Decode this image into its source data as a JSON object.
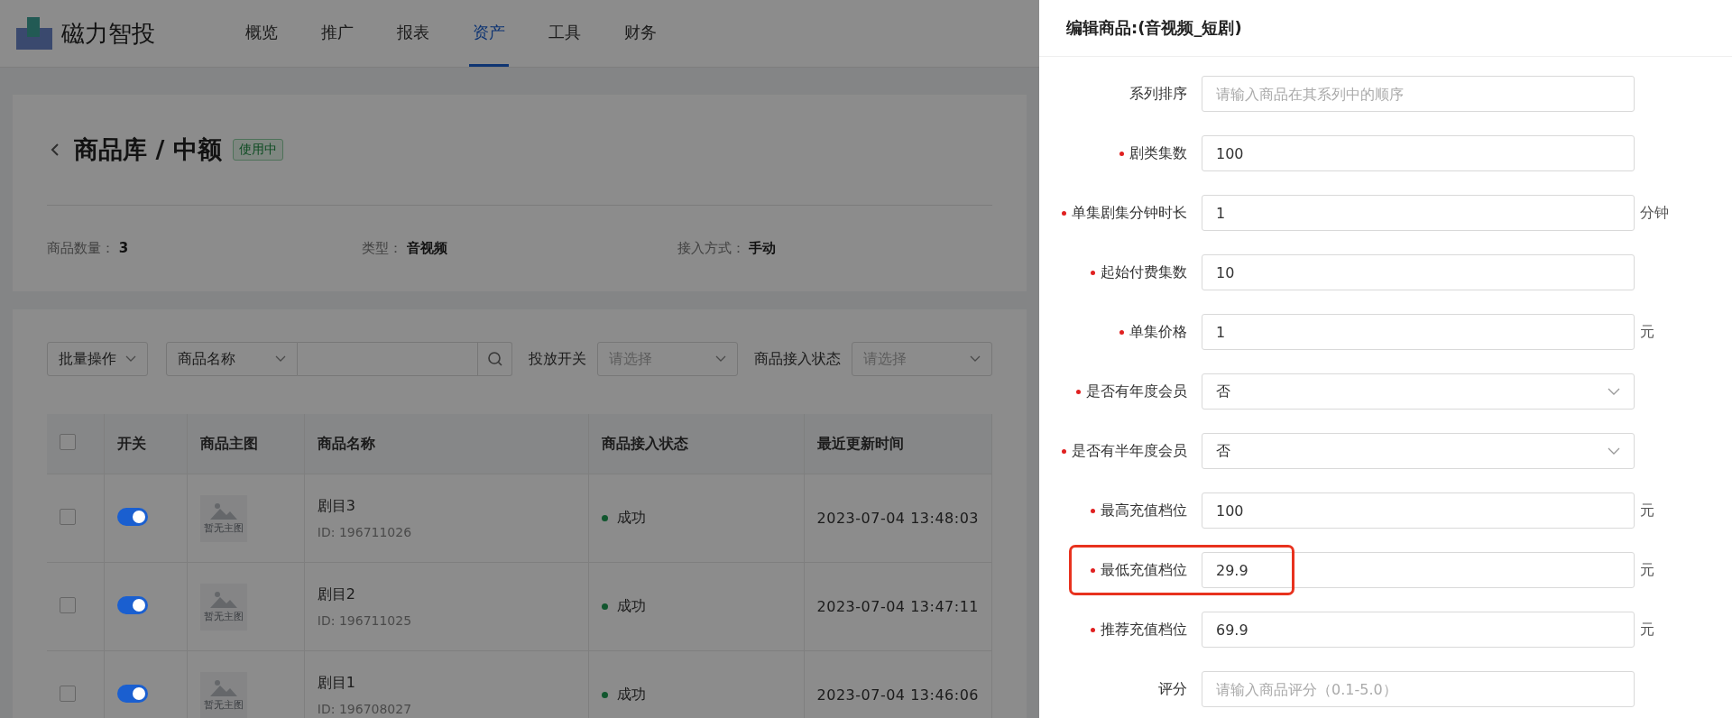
{
  "app": {
    "brand": "磁力智投"
  },
  "nav": [
    {
      "label": "概览",
      "selected": false
    },
    {
      "label": "推广",
      "selected": false
    },
    {
      "label": "报表",
      "selected": false
    },
    {
      "label": "资产",
      "selected": true
    },
    {
      "label": "工具",
      "selected": false
    },
    {
      "label": "财务",
      "selected": false
    }
  ],
  "page": {
    "title": "商品库 / 中额",
    "status_tag": "使用中"
  },
  "stats": [
    {
      "label": "商品数量：",
      "value": "3"
    },
    {
      "label": "类型：",
      "value": "音视频"
    },
    {
      "label": "接入方式：",
      "value": "手动"
    }
  ],
  "toolbar": {
    "batch": "批量操作",
    "search_type": "商品名称",
    "filters": [
      {
        "label": "投放开关",
        "placeholder": "请选择"
      },
      {
        "label": "商品接入状态",
        "placeholder": "请选择"
      }
    ]
  },
  "table": {
    "all_checked": false,
    "columns": [
      "开关",
      "商品主图",
      "商品名称",
      "商品接入状态",
      "最近更新时间"
    ],
    "rows": [
      {
        "checked": false,
        "on": true,
        "image_text": "暂无主图",
        "name": "剧目3",
        "id": "ID: 196711026",
        "status": "成功",
        "time": "2023-07-04 13:48:03"
      },
      {
        "checked": false,
        "on": true,
        "image_text": "暂无主图",
        "name": "剧目2",
        "id": "ID: 196711025",
        "status": "成功",
        "time": "2023-07-04 13:47:11"
      },
      {
        "checked": false,
        "on": true,
        "image_text": "暂无主图",
        "name": "剧目1",
        "id": "ID: 196708027",
        "status": "成功",
        "time": "2023-07-04 13:46:06"
      }
    ]
  },
  "drawer": {
    "title": "编辑商品:(音视频_短剧)",
    "fields": [
      {
        "kind": "input",
        "label": "系列排序",
        "required": false,
        "placeholder": "请输入商品在其系列中的顺序",
        "highlighted": false
      },
      {
        "kind": "input",
        "label": "剧类集数",
        "required": true,
        "value": "100",
        "highlighted": false
      },
      {
        "kind": "input",
        "label": "单集剧集分钟时长",
        "required": true,
        "value": "1",
        "suffix": "分钟",
        "highlighted": false
      },
      {
        "kind": "input",
        "label": "起始付费集数",
        "required": true,
        "value": "10",
        "highlighted": false
      },
      {
        "kind": "input",
        "label": "单集价格",
        "required": true,
        "value": "1",
        "suffix": "元",
        "highlighted": false
      },
      {
        "kind": "select",
        "label": "是否有年度会员",
        "required": true,
        "value": "否",
        "highlighted": false
      },
      {
        "kind": "select",
        "label": "是否有半年度会员",
        "required": true,
        "value": "否",
        "highlighted": false
      },
      {
        "kind": "input",
        "label": "最高充值档位",
        "required": true,
        "value": "100",
        "suffix": "元",
        "highlighted": false
      },
      {
        "kind": "input",
        "label": "最低充值档位",
        "required": true,
        "value": "29.9",
        "suffix": "元",
        "highlighted": true
      },
      {
        "kind": "input",
        "label": "推荐充值档位",
        "required": true,
        "value": "69.9",
        "suffix": "元",
        "highlighted": false
      },
      {
        "kind": "input",
        "label": "评分",
        "required": false,
        "placeholder": "请输入商品评分（0.1-5.0）",
        "highlighted": false
      }
    ]
  }
}
